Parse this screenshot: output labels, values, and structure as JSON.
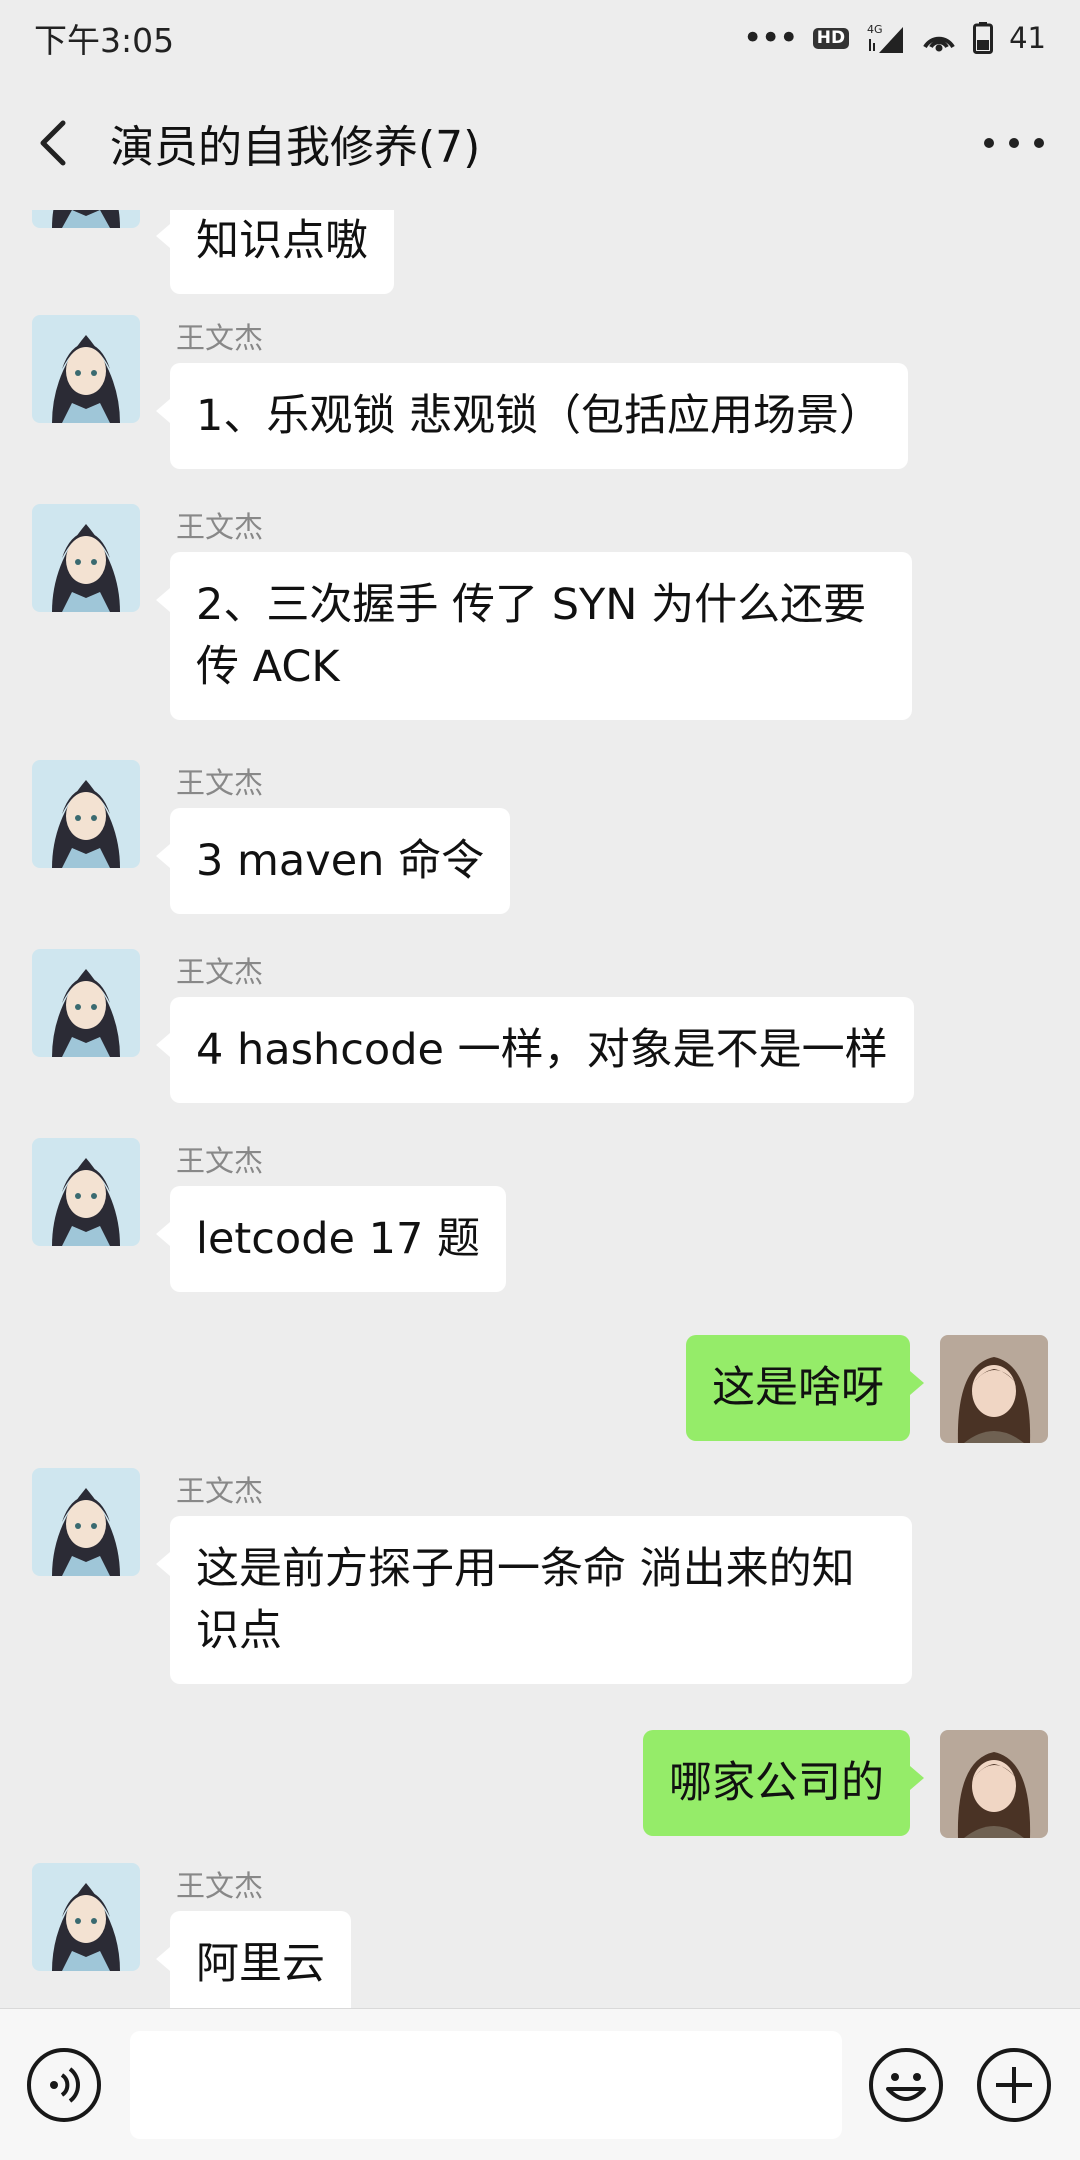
{
  "status_bar": {
    "time": "下午3:05",
    "hd_label": "HD",
    "network_label": "4G",
    "battery_percent": "41"
  },
  "header": {
    "title": "演员的自我修养(7)"
  },
  "messages": [
    {
      "side": "left",
      "sender": "",
      "text": "知识点嗷"
    },
    {
      "side": "left",
      "sender": "王文杰",
      "text": "1、乐观锁 悲观锁（包括应用场景）"
    },
    {
      "side": "left",
      "sender": "王文杰",
      "text": "2、三次握手 传了 SYN 为什么还要传 ACK"
    },
    {
      "side": "left",
      "sender": "王文杰",
      "text": "3 maven 命令"
    },
    {
      "side": "left",
      "sender": "王文杰",
      "text": "4 hashcode 一样，对象是不是一样"
    },
    {
      "side": "left",
      "sender": "王文杰",
      "text": "letcode 17 题"
    },
    {
      "side": "right",
      "sender": "",
      "text": "这是啥呀"
    },
    {
      "side": "left",
      "sender": "王文杰",
      "text": "这是前方探子用一条命 淌出来的知识点"
    },
    {
      "side": "right",
      "sender": "",
      "text": "哪家公司的"
    },
    {
      "side": "left",
      "sender": "王文杰",
      "text": "阿里云"
    }
  ],
  "input_bar": {
    "placeholder": ""
  },
  "colors": {
    "background": "#ededed",
    "bubble_self": "#95ec69",
    "bubble_other": "#ffffff",
    "sender_name": "#888888"
  },
  "icons": {
    "back": "chevron-left-icon",
    "more": "more-dots-icon",
    "voice": "voice-icon",
    "emoji": "emoji-icon",
    "plus": "plus-icon"
  }
}
